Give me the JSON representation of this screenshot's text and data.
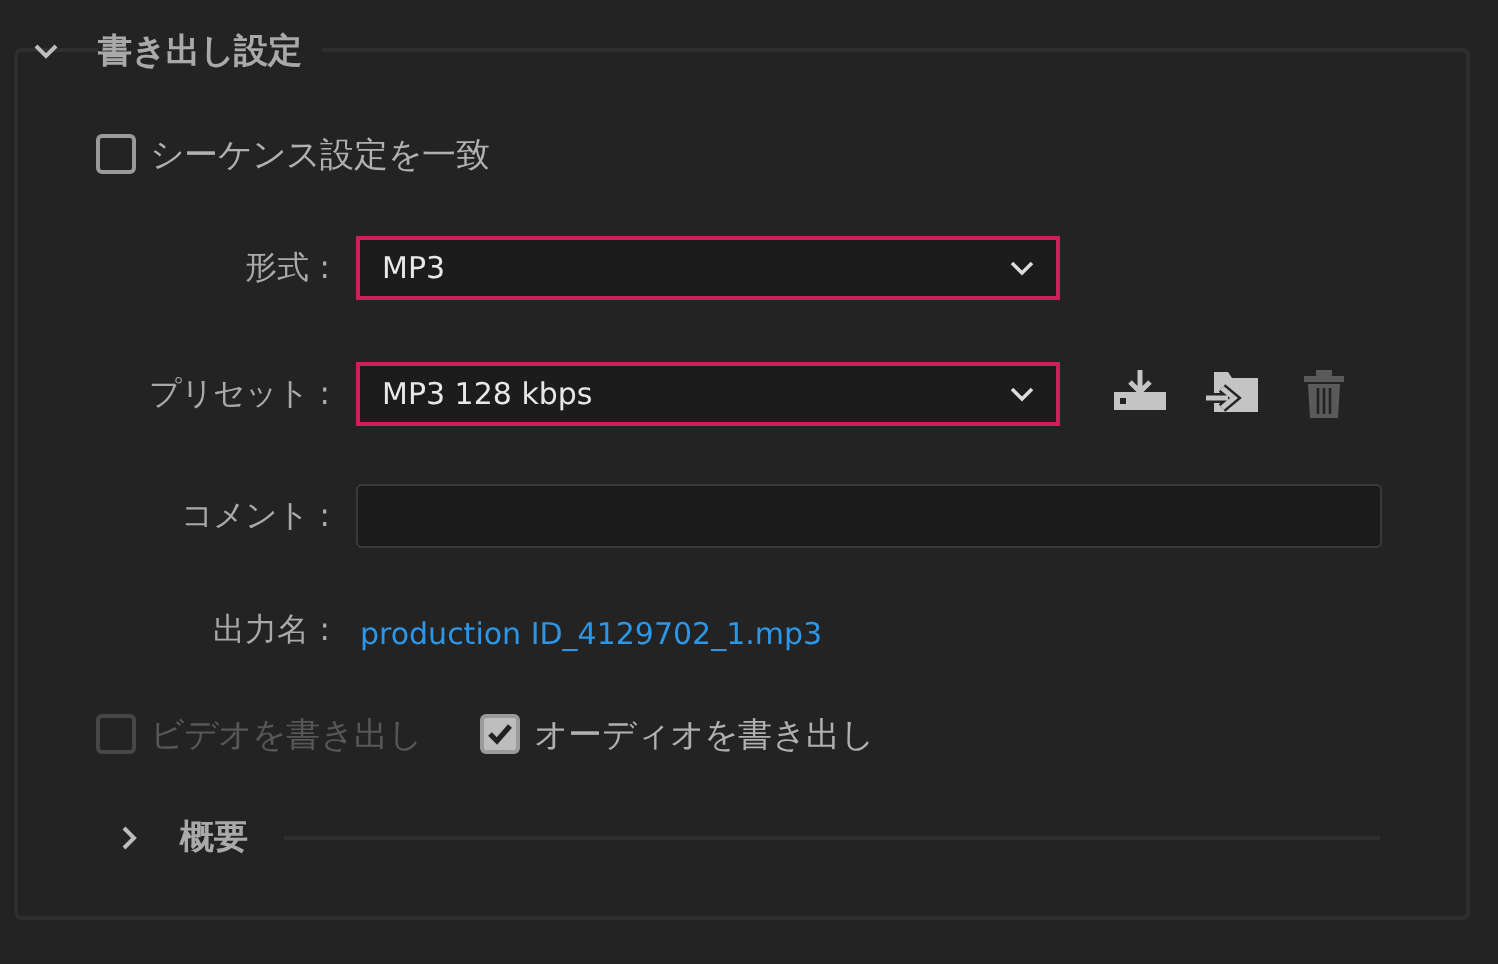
{
  "section": {
    "title": "書き出し設定",
    "expanded": true
  },
  "match_sequence": {
    "label": "シーケンス設定を一致",
    "checked": false
  },
  "fields": [
    {
      "kind": "dropdown",
      "label": "形式 :",
      "value": "MP3",
      "highlighted": true
    },
    {
      "kind": "dropdown",
      "label": "プリセット :",
      "value": "MP3 128 kbps",
      "highlighted": true,
      "actions": [
        {
          "kind": "save",
          "disabled": false
        },
        {
          "kind": "import",
          "disabled": false
        },
        {
          "kind": "delete",
          "disabled": true
        }
      ]
    },
    {
      "kind": "text",
      "label": "コメント :"
    },
    {
      "kind": "link",
      "label": "出力名 :",
      "value": "production ID_4129702_1.mp3"
    }
  ],
  "export_options": [
    {
      "label": "ビデオを書き出し",
      "checked": false,
      "disabled": true
    },
    {
      "label": "オーディオを書き出し",
      "checked": true,
      "disabled": false
    }
  ],
  "summary": {
    "title": "概要",
    "expanded": false
  }
}
